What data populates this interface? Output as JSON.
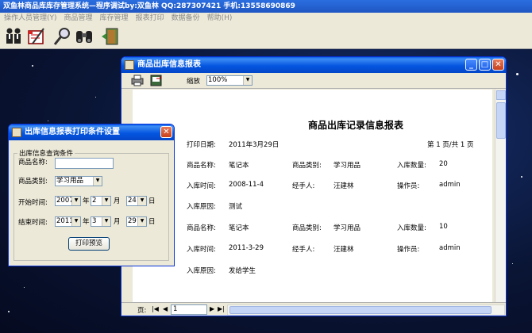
{
  "app": {
    "title": "双鱼林商品库库存管理系统—程序调试by:双鱼林 QQ:287307421 手机:13558690869",
    "menu": [
      "操作人员管理(Y)",
      "商品管理",
      "库存管理",
      "报表打印",
      "数据备份",
      "帮助(H)"
    ],
    "toolbar_icons": [
      "users-icon",
      "edit-form-icon",
      "search-icon",
      "binoculars-icon",
      "exit-door-icon"
    ]
  },
  "report_window": {
    "title": "商品出库信息报表",
    "zoom_label": "缩放",
    "zoom_value": "100%",
    "report_title": "商品出库记录信息报表",
    "print_date_label": "打印日期:",
    "print_date": "2011年3月29日",
    "page_info": "第  1  页/共  1  页",
    "page_label": "页:",
    "page_number": "1",
    "records": [
      {
        "name_label": "商品名称:",
        "name": "笔记本",
        "type_label": "商品类别:",
        "type": "学习用品",
        "qty_label": "入库数量:",
        "qty": "20",
        "time_label": "入库时间:",
        "time": "2008-11-4",
        "handler_label": "经手人:",
        "handler": "汪建林",
        "operator_label": "操作员:",
        "operator": "admin",
        "reason_label": "入库原因:",
        "reason": "测试"
      },
      {
        "name_label": "商品名称:",
        "name": "笔记本",
        "type_label": "商品类别:",
        "type": "学习用品",
        "qty_label": "入库数量:",
        "qty": "10",
        "time_label": "入库时间:",
        "time": "2011-3-29",
        "handler_label": "经手人:",
        "handler": "汪建林",
        "operator_label": "操作员:",
        "operator": "admin",
        "reason_label": "入库原因:",
        "reason": "发给学生"
      }
    ]
  },
  "condition_dialog": {
    "title": "出库信息报表打印条件设置",
    "group_label": "出库信息查询条件",
    "name_label": "商品名称:",
    "name_value": "",
    "type_label": "商品类别:",
    "type_value": "学习用品",
    "start_label": "开始时间:",
    "start_year": "2007",
    "start_month": "2",
    "start_day": "24",
    "end_label": "结束时间:",
    "end_year": "2011",
    "end_month": "3",
    "end_day": "29",
    "year_unit": "年",
    "month_unit": "月",
    "day_unit": "日",
    "preview_button": "打印预览"
  },
  "colors": {
    "title_bar": "#0556e0",
    "window_face": "#ece9d8",
    "desktop": "#0a1535"
  }
}
